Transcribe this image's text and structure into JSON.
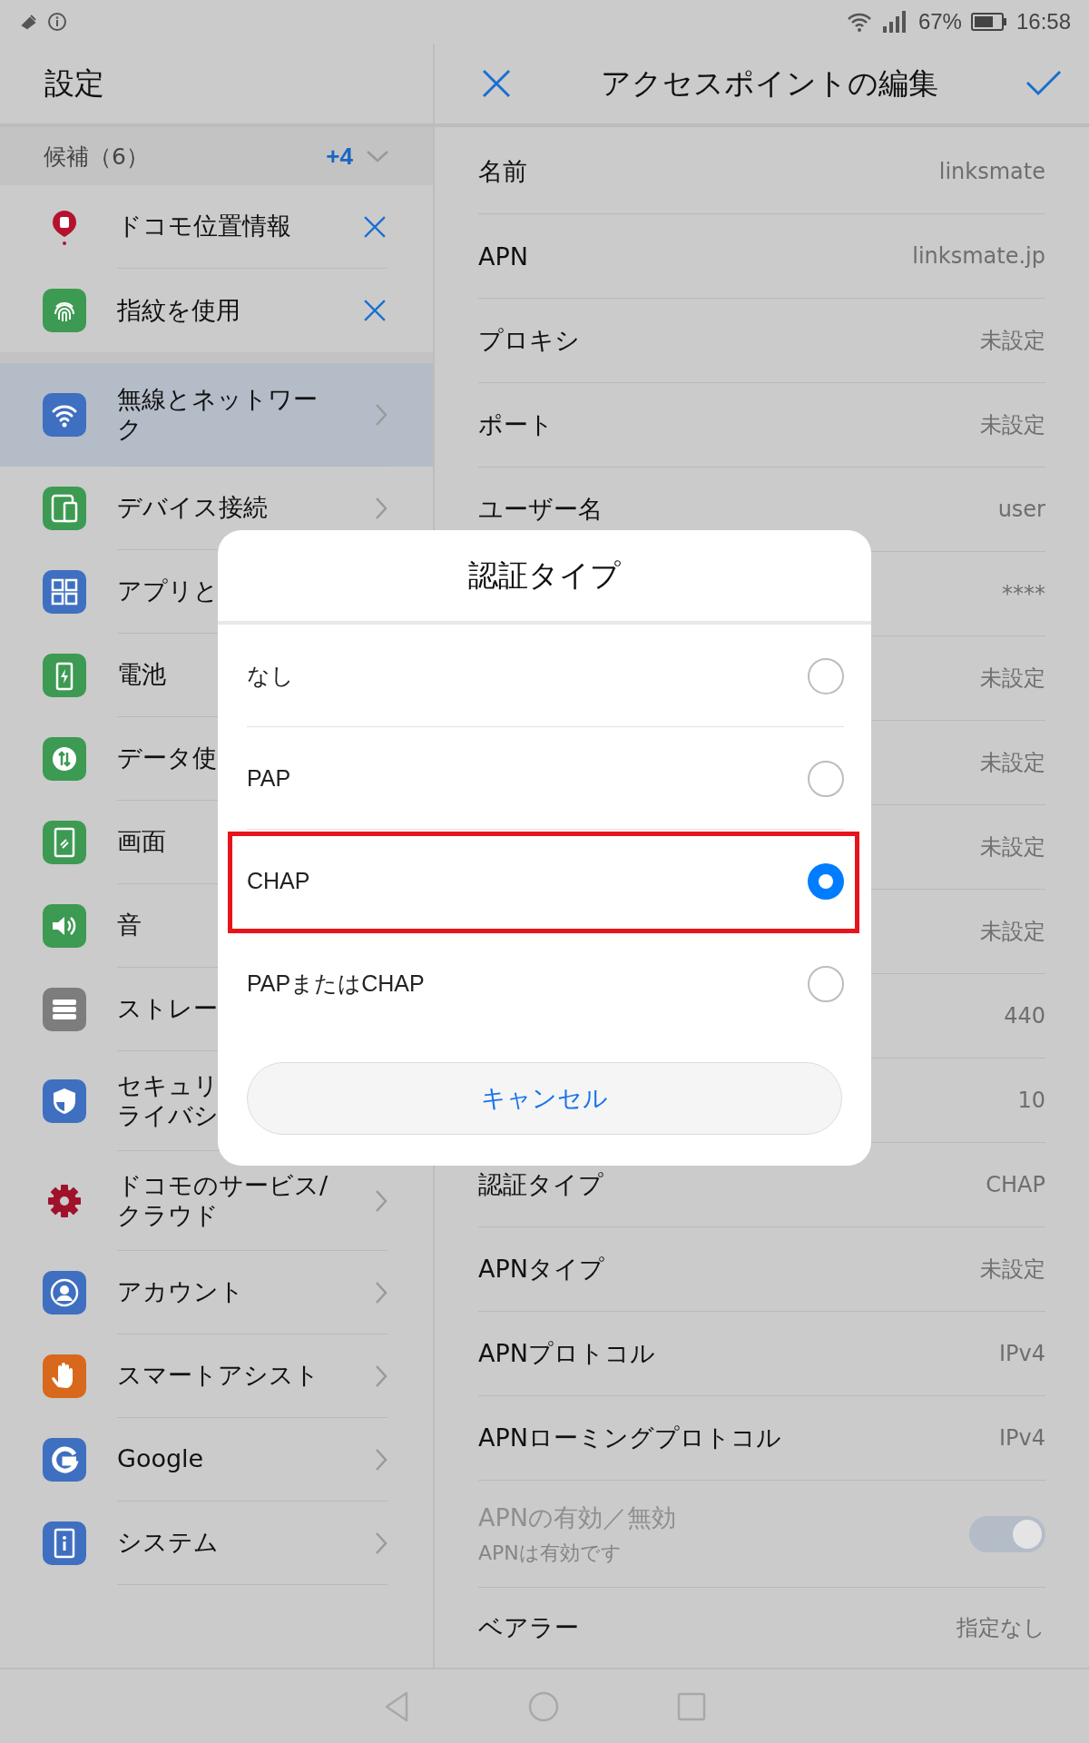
{
  "status_bar": {
    "battery_text": "67%",
    "time": "16:58"
  },
  "settings": {
    "title": "設定",
    "suggestions": {
      "label": "候補（6）",
      "more": "+4",
      "expanded": false,
      "items": [
        {
          "label": "ドコモ位置情報"
        },
        {
          "label": "指紋を使用"
        }
      ]
    },
    "items": [
      {
        "label": "無線とネットワーク",
        "selected": true
      },
      {
        "label": "デバイス接続",
        "selected": false
      },
      {
        "label": "アプリと",
        "selected": false
      },
      {
        "label": "電池",
        "selected": false
      },
      {
        "label": "データ使",
        "selected": false
      },
      {
        "label": "画面",
        "selected": false
      },
      {
        "label": "音",
        "selected": false
      },
      {
        "label": "ストレー",
        "selected": false
      },
      {
        "lines": [
          "セキュリ",
          "ライバシ"
        ],
        "selected": false
      },
      {
        "label": "ドコモのサービス/クラウド",
        "selected": false
      },
      {
        "label": "アカウント",
        "selected": false
      },
      {
        "label": "スマートアシスト",
        "selected": false
      },
      {
        "label": "Google",
        "selected": false
      },
      {
        "label": "システム",
        "selected": false
      }
    ]
  },
  "editor": {
    "title": "アクセスポイントの編集",
    "rows": [
      {
        "kind": "value",
        "label": "名前",
        "value": "linksmate"
      },
      {
        "kind": "value",
        "label": "APN",
        "value": "linksmate.jp"
      },
      {
        "kind": "value",
        "label": "プロキシ",
        "value": "未設定"
      },
      {
        "kind": "value",
        "label": "ポート",
        "value": "未設定"
      },
      {
        "kind": "value",
        "label": "ユーザー名",
        "value": "user"
      },
      {
        "kind": "value",
        "value": "****"
      },
      {
        "kind": "value",
        "value": "未設定"
      },
      {
        "kind": "value",
        "value": "未設定"
      },
      {
        "kind": "value",
        "value": "未設定"
      },
      {
        "kind": "value",
        "value": "未設定"
      },
      {
        "kind": "value",
        "value": "440"
      },
      {
        "kind": "value",
        "value": "10"
      },
      {
        "kind": "value",
        "label": "認証タイプ",
        "value": "CHAP"
      },
      {
        "kind": "value",
        "label": "APNタイプ",
        "value": "未設定"
      },
      {
        "kind": "value",
        "label": "APNプロトコル",
        "value": "IPv4"
      },
      {
        "kind": "value",
        "label": "APNローミングプロトコル",
        "value": "IPv4"
      },
      {
        "kind": "toggle",
        "label": "APNの有効／無効",
        "sublabel": "APNは有効です",
        "on": true,
        "disabled": true
      },
      {
        "kind": "value",
        "label": "ベアラー",
        "value": "指定なし"
      }
    ]
  },
  "dialog": {
    "title": "認証タイプ",
    "options": [
      {
        "label": "なし",
        "selected": false,
        "highlighted": false
      },
      {
        "label": "PAP",
        "selected": false,
        "highlighted": false
      },
      {
        "label": "CHAP",
        "selected": true,
        "highlighted": true
      },
      {
        "label": "PAPまたはCHAP",
        "selected": false,
        "highlighted": false
      }
    ],
    "cancel": "キャンセル"
  }
}
